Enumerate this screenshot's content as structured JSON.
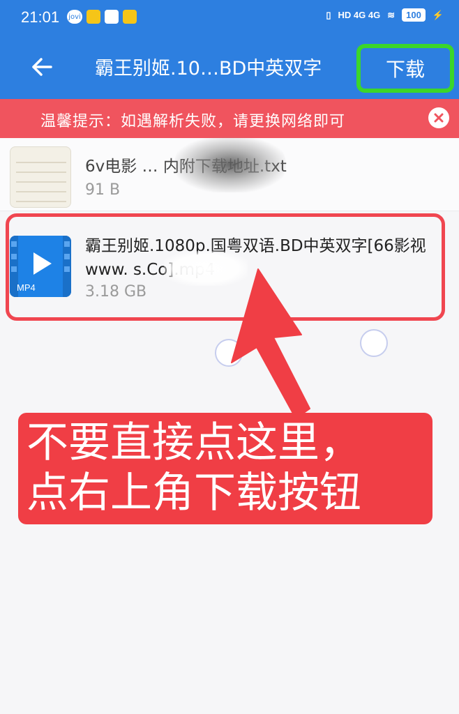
{
  "status_bar": {
    "time": "21:01",
    "icons": [
      "jovi-icon",
      "meituan-icon",
      "shopping-bag-icon",
      "taxi-icon"
    ],
    "network": "HD 4G 4G",
    "battery": "100"
  },
  "toolbar": {
    "title": "霸王别姬.10…BD中英双字",
    "download_label": "下载"
  },
  "banner": {
    "text": "温馨提示：如遇解析失败，请更换网络即可"
  },
  "files": [
    {
      "name": "6v电影 … 内附下载地址.txt",
      "size": "91 B",
      "icon": "txt-file-icon"
    },
    {
      "name": "霸王别姬.1080p.国粤双语.BD中英双字[66影视www.  s.Co].mp4",
      "size": "3.18 GB",
      "icon": "mp4-file-icon",
      "icon_label": "MP4"
    }
  ],
  "callout": {
    "line1": "不要直接点这里，",
    "line2": "点右上角下载按钮"
  },
  "colors": {
    "primary": "#2d7fe0",
    "banner": "#f0545e",
    "highlight": "#3bd62a",
    "annotation": "#f03e45"
  }
}
